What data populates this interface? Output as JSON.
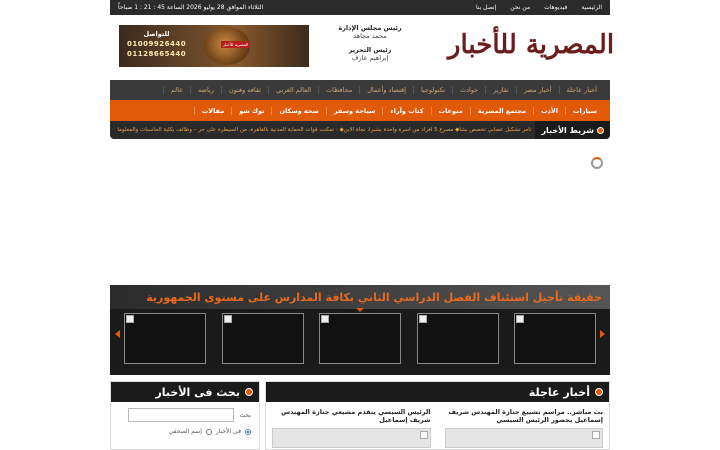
{
  "topbar": {
    "nav": [
      "الرئيسية",
      "فيديوهات",
      "من نحن",
      "إتصل بنا"
    ],
    "date": "الثلاثاء الموافق 28 يوليو 2026 الساعة 45 : 21 : 1 صباحاً"
  },
  "header": {
    "logo_text": "المصرية للأخبار",
    "board_chair_role": "رئيس مجلس الإدارة",
    "board_chair_name": "محمد مجاهد",
    "editor_role": "رئيس التحرير",
    "editor_name": "إبراهيم عارف",
    "ad": {
      "badge": "المصرية للأخبار",
      "contact_label": "للتواصل",
      "phone_1": "01009926440",
      "phone_2": "01128665440"
    }
  },
  "nav_primary": [
    "أخبار عاجلة",
    "أخبار مصر",
    "تقارير",
    "حوادث",
    "تكنولوجيا",
    "إقتصاد وأعمال",
    "محافظات",
    "العالم العربي",
    "ثقافه وفنون",
    "رياضه",
    "عالم"
  ],
  "nav_secondary": [
    "سيارات",
    "الأدب",
    "مجتمع المصرية",
    "منوعات",
    "كتاب وآراء",
    "سياحة وسفر",
    "صحة وسكان",
    "توك شو",
    "مقالات"
  ],
  "ticker": {
    "label": "شريط الأخبار",
    "text": "تامر تشكيل عصابي تخصص بشأ◆ مصرع 5 أفراد من أسرة واحدة بشبرا، نجاة الابن◆ : تمكنت قوات الحماية المدنية بالقاهرة، من السيطرة على حر – وظائف بكلية الحاسبات والمعلوما"
  },
  "slider": {
    "headline": "حقيقة تأجيل استئناف الفصل الدراسي الثاني بكافة المدارس على مستوى الجمهورية",
    "thumb_count": 5
  },
  "breaking": {
    "title": "أخبار عاجلة",
    "items": [
      {
        "title": "بث مباشر.. مراسم تشييع جنازة المهندس شريف إسماعيل بحضور الرئيس السيسي"
      },
      {
        "title": "الرئيس السيسي يتقدم مشيعي جنازة المهندس شريف إسماعيل"
      }
    ]
  },
  "search": {
    "title": "بحث فى الأخبار",
    "label": "بحث",
    "input_value": "",
    "option_news": "فى الأخبار",
    "option_journalist": "إسم الصحفي"
  }
}
